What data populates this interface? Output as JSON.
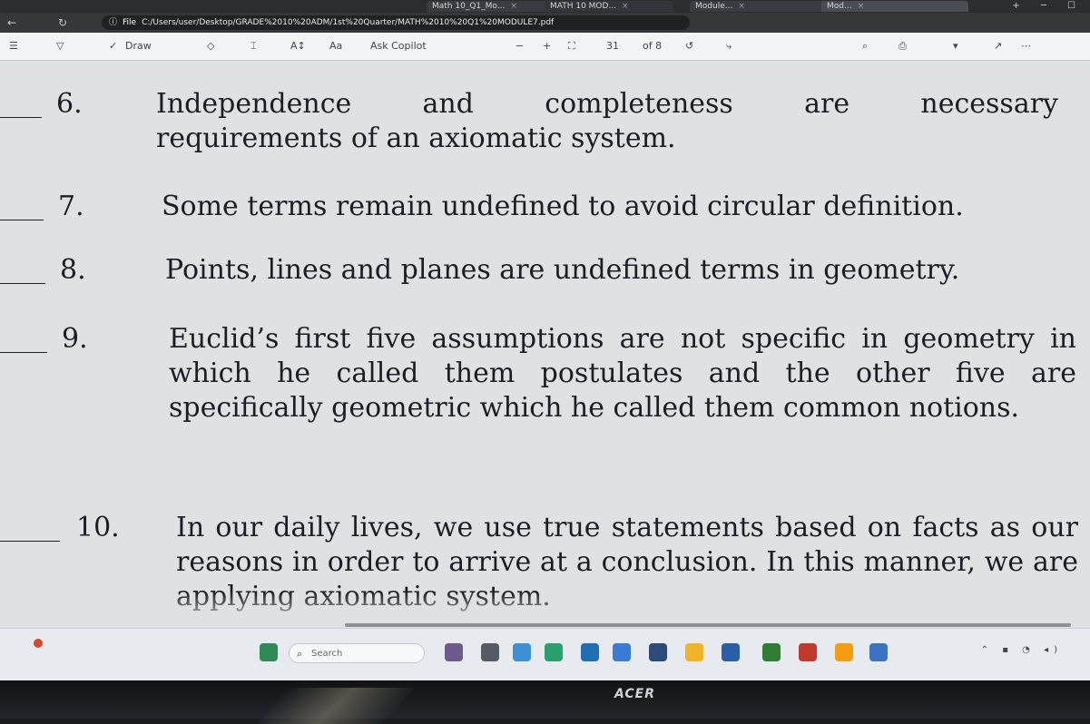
{
  "browser": {
    "tabs": [
      {
        "label": "Math 10_Q1_Mo..."
      },
      {
        "label": "MATH 10 MOD..."
      },
      {
        "label": "Module..."
      },
      {
        "label": "Mod..."
      }
    ],
    "url_prefix": "File",
    "url": "C:/Users/user/Desktop/GRADE%2010%20ADM/1st%20Quarter/MATH%2010%20Q1%20MODULE7.pdf"
  },
  "pdf_toolbar": {
    "draw_label": "Draw",
    "text_size_label": "Aa",
    "read_aloud_label": "Ask Copilot",
    "page_current": "31",
    "page_total": "of 8"
  },
  "document": {
    "items": [
      {
        "number": "6.",
        "text": "Independence and completeness are necessary requirements of an axiomatic system."
      },
      {
        "number": "7.",
        "text": "Some terms remain undefined to avoid circular definition."
      },
      {
        "number": "8.",
        "text": "Points, lines and planes are undefined terms in geometry."
      },
      {
        "number": "9.",
        "text": "Euclid’s first five assumptions are not specific in geometry in which he called them postulates and the other five are specifically geometric which he called them common notions."
      },
      {
        "number": "10.",
        "text": "In our daily lives, we use true statements based on facts as our reasons in order to arrive at a conclusion. In this manner, we are applying axiomatic system."
      }
    ]
  },
  "taskbar": {
    "search_placeholder": "Search",
    "search_icon": "search-icon"
  },
  "monitor": {
    "brand": "ACER"
  },
  "colors": {
    "page_bg": "#dfe2e4",
    "text": "#1b1e24",
    "browser_chrome": "#2b2d31"
  }
}
